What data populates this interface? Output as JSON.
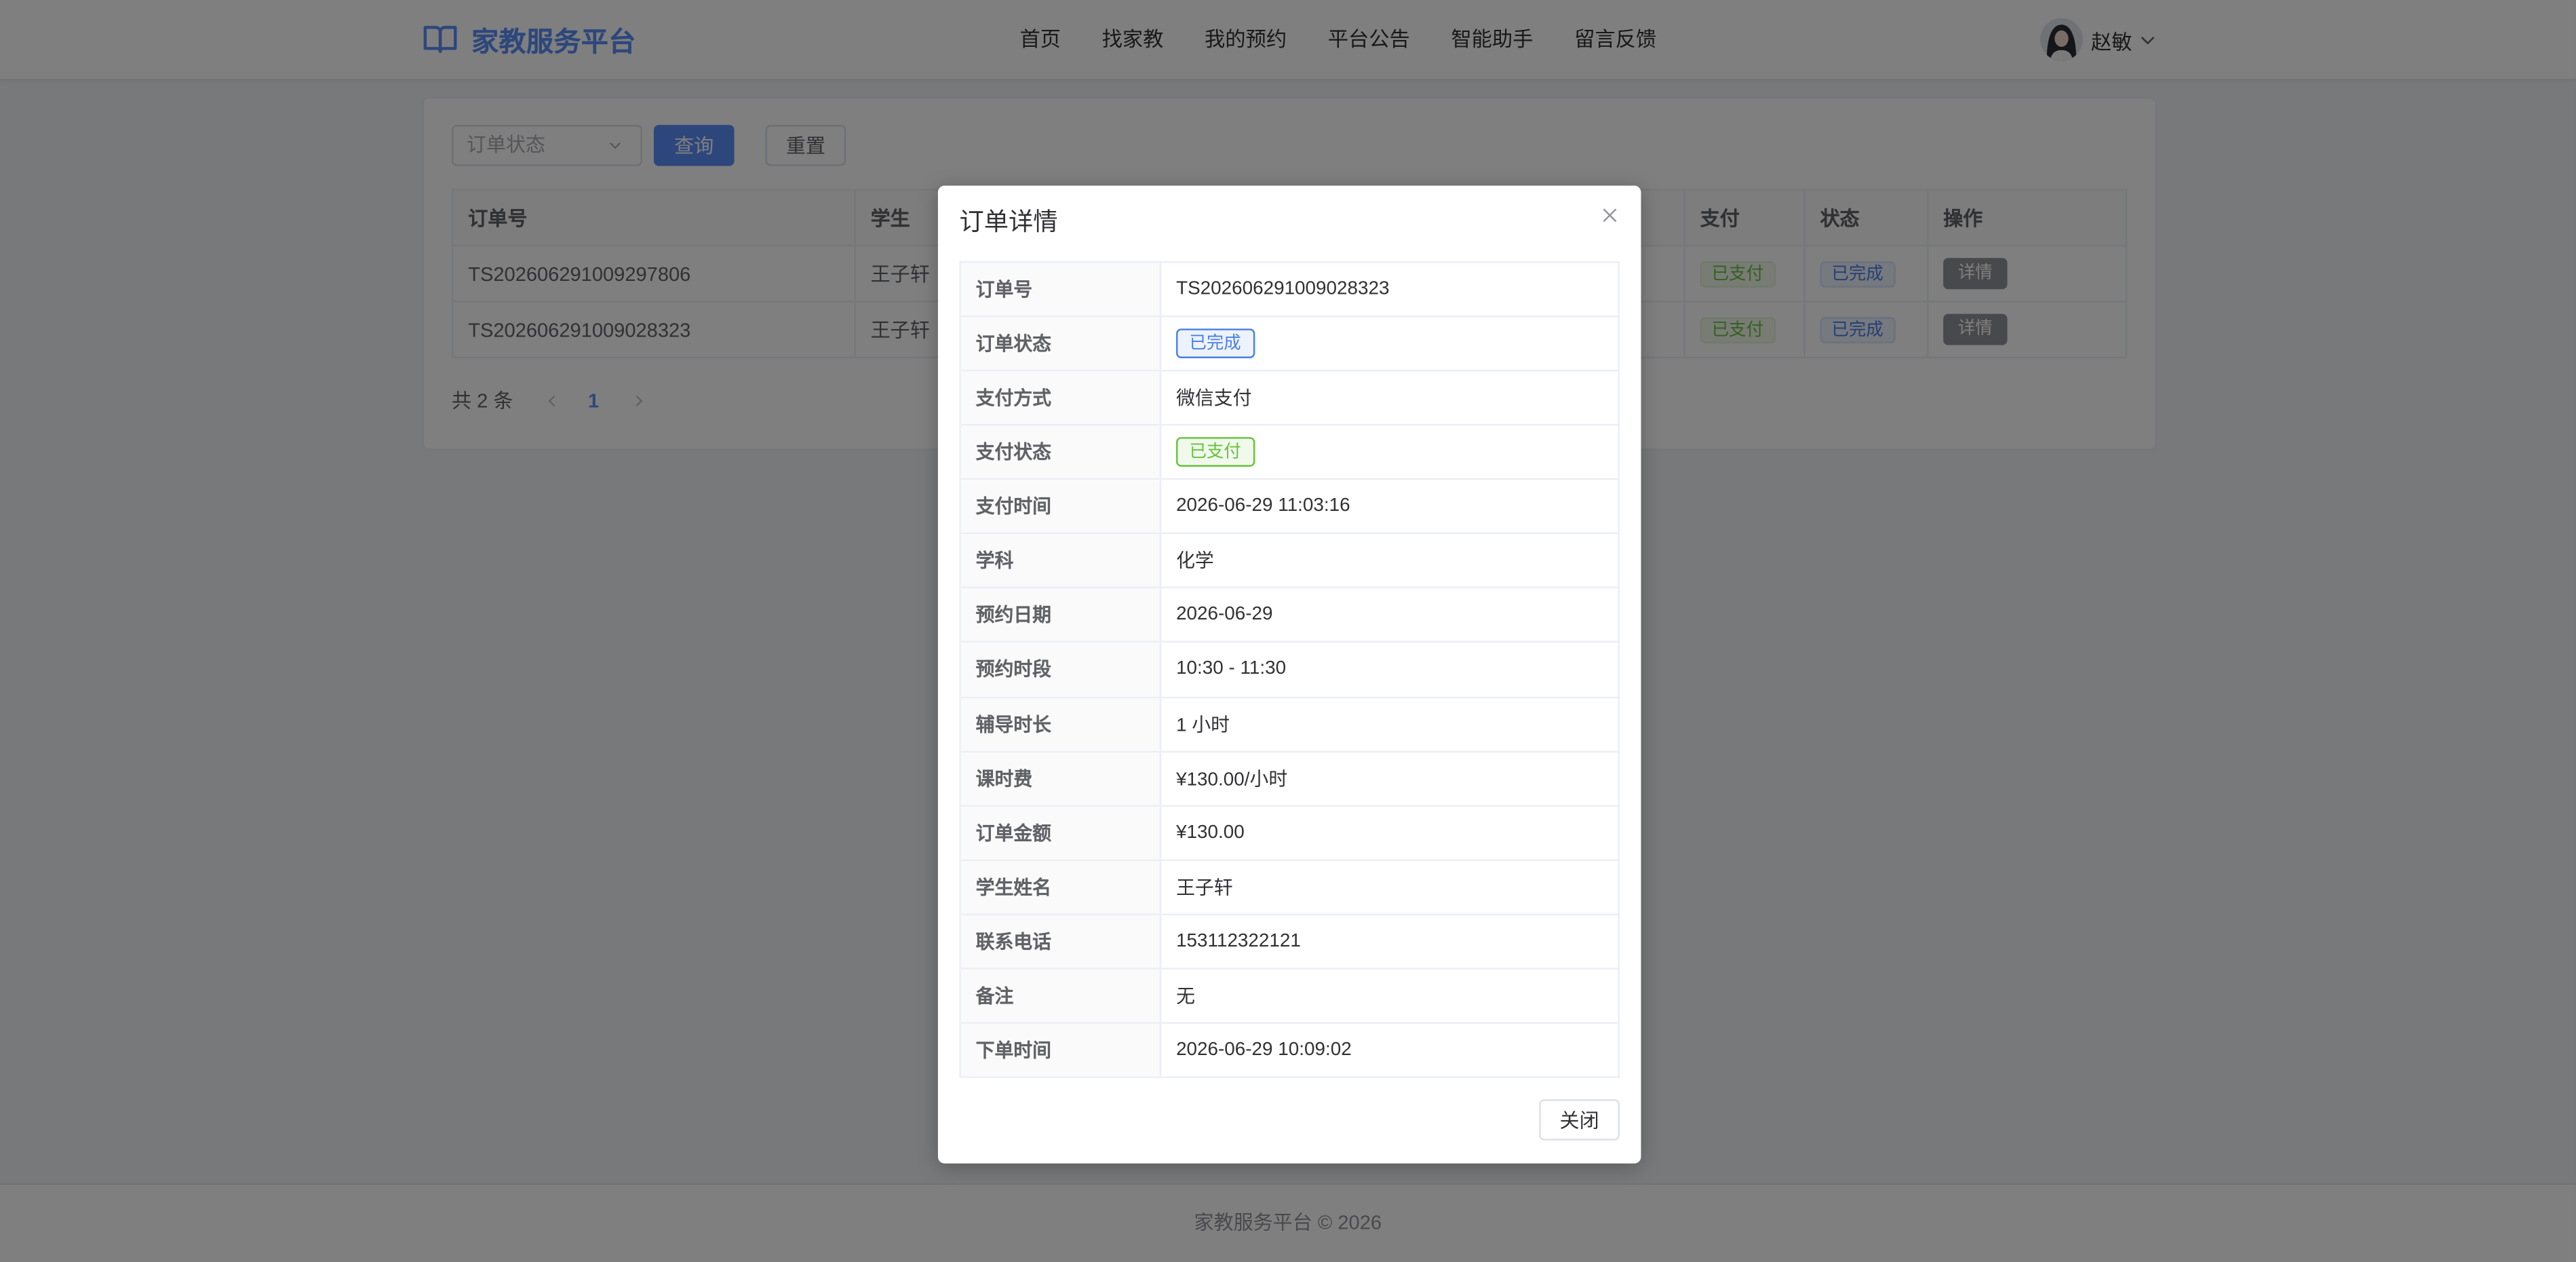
{
  "app": {
    "logo_text": "家教服务平台"
  },
  "nav": {
    "items": [
      {
        "label": "首页"
      },
      {
        "label": "找家教"
      },
      {
        "label": "我的预约"
      },
      {
        "label": "平台公告"
      },
      {
        "label": "智能助手"
      },
      {
        "label": "留言反馈"
      }
    ]
  },
  "user": {
    "name": "赵敏"
  },
  "filters": {
    "status_placeholder": "订单状态",
    "query_label": "查询",
    "reset_label": "重置"
  },
  "orders_table": {
    "columns": [
      "订单号",
      "学生",
      "支付",
      "状态",
      "操作"
    ],
    "rows": [
      {
        "order_no": "TS202606291009297806",
        "student": "王子轩",
        "payment": "已支付",
        "status": "已完成",
        "action": "详情"
      },
      {
        "order_no": "TS202606291009028323",
        "student": "王子轩",
        "payment": "已支付",
        "status": "已完成",
        "action": "详情"
      }
    ]
  },
  "pagination": {
    "total_text": "共 2 条",
    "current_page": "1"
  },
  "footer": {
    "copyright": "家教服务平台 © 2026"
  },
  "modal": {
    "title": "订单详情",
    "fields": [
      {
        "label": "订单号",
        "value": "TS202606291009028323"
      },
      {
        "label": "订单状态",
        "value": "已完成",
        "tag_color": "#4a7ee6"
      },
      {
        "label": "支付方式",
        "value": "微信支付"
      },
      {
        "label": "支付状态",
        "value": "已支付",
        "tag_color": "#67c23a"
      },
      {
        "label": "支付时间",
        "value": "2026-06-29 11:03:16"
      },
      {
        "label": "学科",
        "value": "化学"
      },
      {
        "label": "预约日期",
        "value": "2026-06-29"
      },
      {
        "label": "预约时段",
        "value": "10:30 - 11:30"
      },
      {
        "label": "辅导时长",
        "value": "1 小时"
      },
      {
        "label": "课时费",
        "value": "¥130.00/小时"
      },
      {
        "label": "订单金额",
        "value": "¥130.00"
      },
      {
        "label": "学生姓名",
        "value": "王子轩"
      },
      {
        "label": "联系电话",
        "value": "153112322121"
      },
      {
        "label": "备注",
        "value": "无"
      },
      {
        "label": "下单时间",
        "value": "2026-06-29 10:09:02"
      }
    ],
    "close_label": "关闭"
  },
  "icons": {
    "logo": "book-open-icon",
    "user_menu": "chevron-down-icon",
    "select": "chevron-down-icon",
    "prev": "chevron-left-icon",
    "next": "chevron-right-icon",
    "modal_close": "close-icon"
  },
  "colors": {
    "primary": "#5b8ff9",
    "success": "#67c23a",
    "info": "#909399",
    "mask": "rgba(0,0,0,0.5)"
  }
}
